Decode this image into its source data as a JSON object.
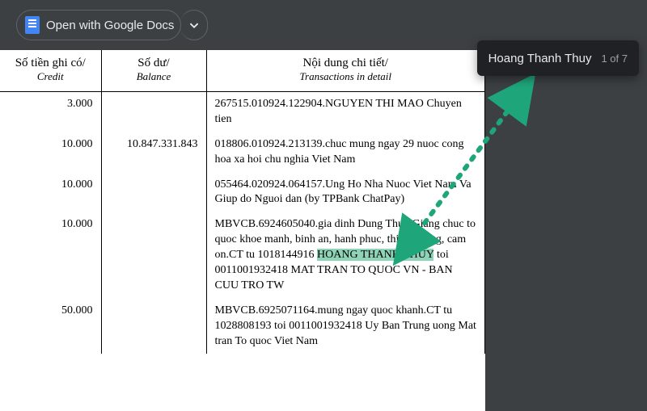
{
  "chrome": {
    "open_button": "Open with Google Docs"
  },
  "search": {
    "query": "Hoang Thanh Thuy",
    "count": "1 of 7"
  },
  "headers": {
    "credit_vn": "Số tiền ghi có/",
    "credit_en": "Credit",
    "balance_vn": "Số dư/",
    "balance_en": "Balance",
    "detail_vn": "Nội dung chi tiết/",
    "detail_en": "Transactions in detail"
  },
  "rows": [
    {
      "credit": "3.000",
      "balance": "",
      "detail": "267515.010924.122904.NGUYEN THI MAO Chuyen tien"
    },
    {
      "credit": "10.000",
      "balance": "10.847.331.843",
      "detail": "018806.010924.213139.chuc mung ngay 29 nuoc cong hoa xa hoi chu nghia Viet Nam"
    },
    {
      "credit": "10.000",
      "balance": "",
      "detail": "055464.020924.064157.Ung Ho Nha Nuoc Viet Nam Va Giup do Nguoi dan (by TPBank ChatPay)"
    },
    {
      "credit": "10.000",
      "balance": "",
      "detail_pre": "MBVCB.6924605040.gia dinh Dung Thuy Giang chuc to quoc khoe manh, binh an, hanh phuc, thinh vuong, cam on.CT tu 1018144916 ",
      "detail_hl": "HOANG THANH THUY",
      "detail_post": " toi 0011001932418 MAT TRAN TO QUOC VN - BAN CUU TRO TW"
    },
    {
      "credit": "50.000",
      "balance": "",
      "detail": "MBVCB.6925071164.mung ngay quoc khanh.CT tu 1028808193 toi 0011001932418 Uy Ban Trung uong Mat tran To quoc Viet Nam"
    }
  ]
}
